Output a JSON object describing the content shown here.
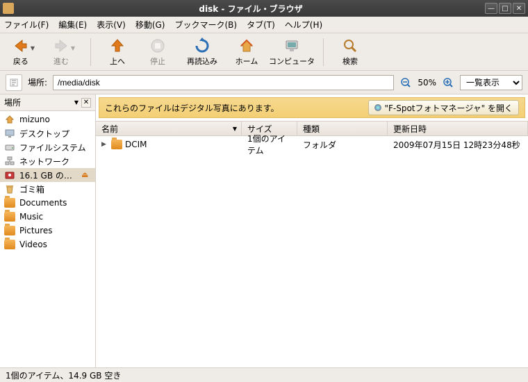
{
  "window": {
    "title": "disk - ファイル・ブラウザ"
  },
  "menu": {
    "file": "ファイル(F)",
    "edit": "編集(E)",
    "view": "表示(V)",
    "go": "移動(G)",
    "bookmarks": "ブックマーク(B)",
    "tabs": "タブ(T)",
    "help": "ヘルプ(H)"
  },
  "toolbar": {
    "back": "戻る",
    "forward": "進む",
    "up": "上へ",
    "stop": "停止",
    "reload": "再読込み",
    "home": "ホーム",
    "computer": "コンピュータ",
    "search": "検索"
  },
  "location": {
    "label": "場所:",
    "path": "/media/disk",
    "zoom": "50%",
    "view_mode": "一覧表示"
  },
  "sidebar": {
    "header": "場所",
    "items": [
      {
        "name": "mizuno",
        "icon": "home",
        "selected": false
      },
      {
        "name": "デスクトップ",
        "icon": "desktop",
        "selected": false
      },
      {
        "name": "ファイルシステム",
        "icon": "drive",
        "selected": false
      },
      {
        "name": "ネットワーク",
        "icon": "network",
        "selected": false
      },
      {
        "name": "16.1 GB のメデ...",
        "icon": "media",
        "selected": true,
        "ejectable": true
      },
      {
        "name": "ゴミ箱",
        "icon": "trash",
        "selected": false
      },
      {
        "name": "Documents",
        "icon": "folder",
        "selected": false
      },
      {
        "name": "Music",
        "icon": "folder",
        "selected": false
      },
      {
        "name": "Pictures",
        "icon": "folder",
        "selected": false
      },
      {
        "name": "Videos",
        "icon": "folder",
        "selected": false
      }
    ]
  },
  "infobar": {
    "message": "これらのファイルはデジタル写真にあります。",
    "button": "\"F-Spotフォトマネージャ\" を開く"
  },
  "columns": {
    "name": "名前",
    "size": "サイズ",
    "type": "種類",
    "date": "更新日時"
  },
  "files": [
    {
      "name": "DCIM",
      "size": "1個のアイテム",
      "type": "フォルダ",
      "date": "2009年07月15日 12時23分48秒"
    }
  ],
  "status": "1個のアイテム、14.9 GB 空き"
}
